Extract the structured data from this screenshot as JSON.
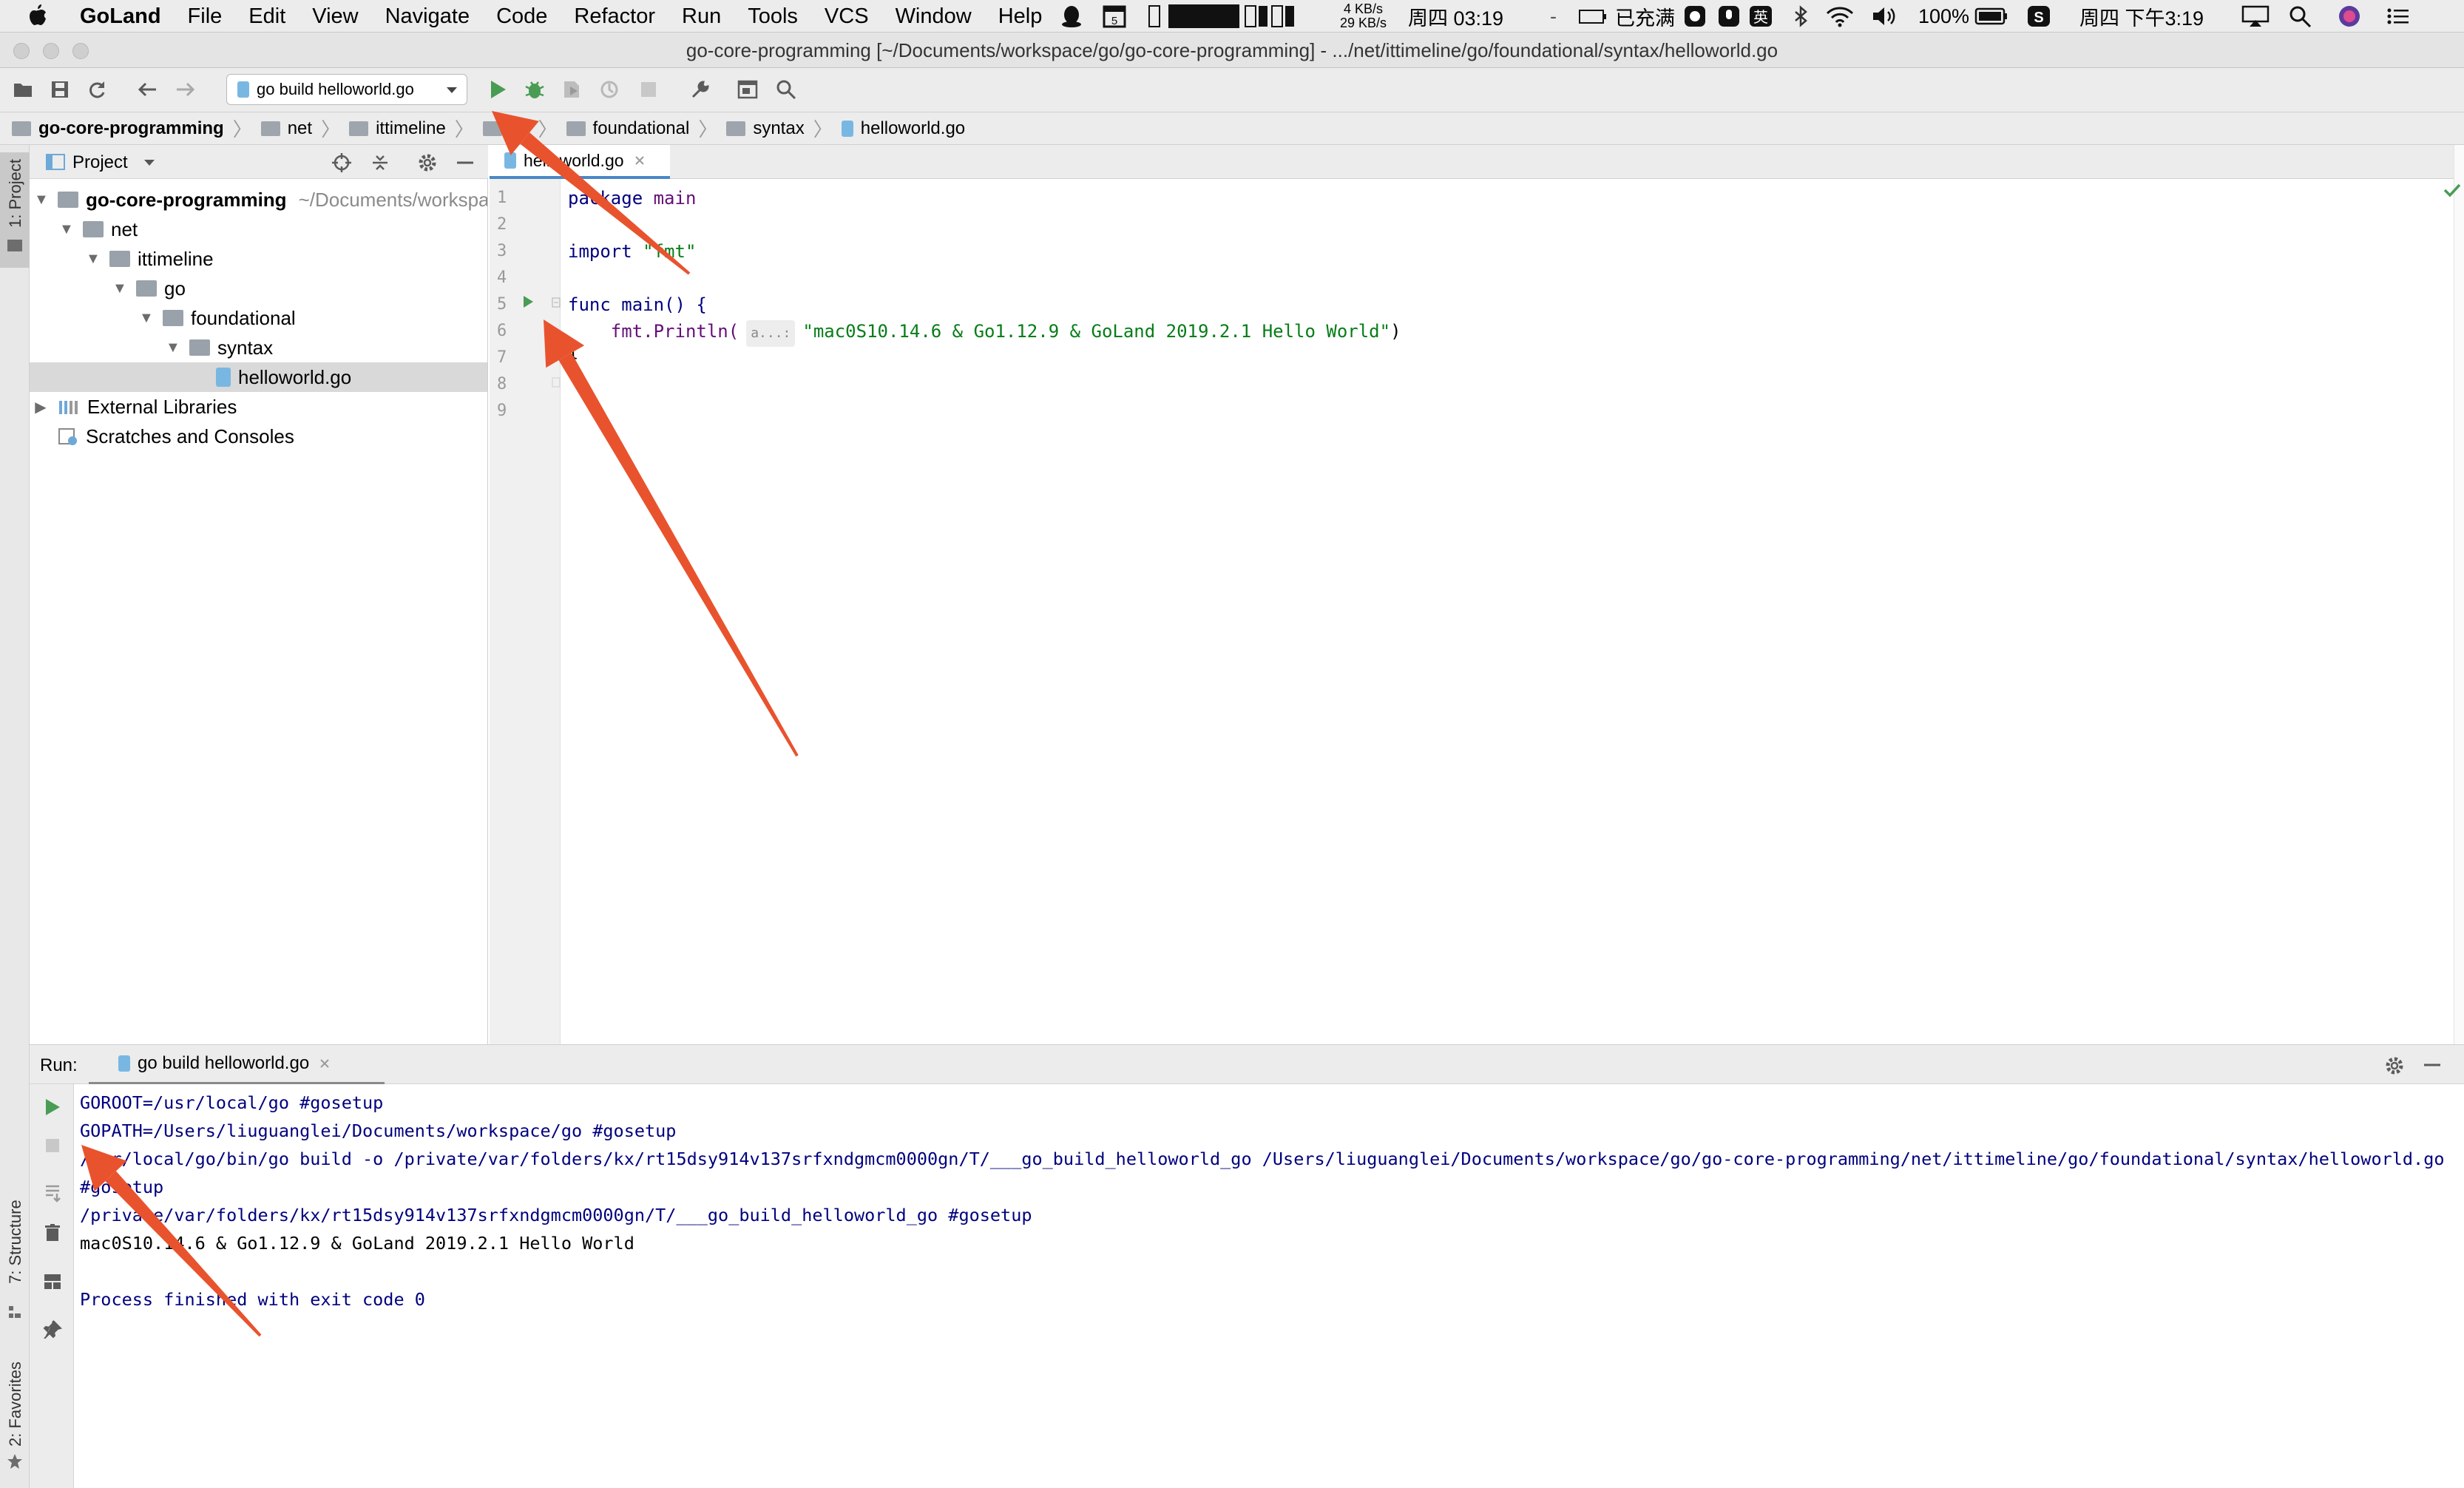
{
  "menubar": {
    "app": "GoLand",
    "menus": [
      "File",
      "Edit",
      "View",
      "Navigate",
      "Code",
      "Refactor",
      "Run",
      "Tools",
      "VCS",
      "Window",
      "Help"
    ],
    "status": {
      "net_up": "4 KB/s",
      "net_down": "29 KB/s",
      "clock_small": "周四 03:19",
      "battery_status": "已充满",
      "input_method": "英",
      "battery": "100%",
      "clock": "周四 下午3:19"
    }
  },
  "window": {
    "title": "go-core-programming [~/Documents/workspace/go/go-core-programming] - .../net/ittimeline/go/foundational/syntax/helloworld.go"
  },
  "toolbar": {
    "run_config": "go build helloworld.go"
  },
  "navbar": {
    "crumbs": [
      "go-core-programming",
      "net",
      "ittimeline",
      "go",
      "foundational",
      "syntax",
      "helloworld.go"
    ]
  },
  "side_tabs": {
    "project": "1: Project",
    "structure": "7: Structure",
    "favorites": "2: Favorites"
  },
  "project_panel": {
    "title": "Project",
    "tree": [
      {
        "label": "go-core-programming",
        "path": "~/Documents/workspace/go/go-core-programming"
      },
      {
        "label": "net"
      },
      {
        "label": "ittimeline"
      },
      {
        "label": "go"
      },
      {
        "label": "foundational"
      },
      {
        "label": "syntax"
      },
      {
        "label": "helloworld.go"
      },
      {
        "label": "External Libraries"
      },
      {
        "label": "Scratches and Consoles"
      }
    ]
  },
  "editor": {
    "tab": "helloworld.go",
    "line_numbers": [
      "1",
      "2",
      "3",
      "4",
      "5",
      "6",
      "7",
      "8",
      "9"
    ],
    "code": {
      "l1_kw": "package",
      "l1_name": " main",
      "l3_kw": "import",
      "l3_str": " \"fmt\"",
      "l5": "func main() {",
      "l6_call": "    fmt.Println(",
      "l6_hint": "a...:",
      "l6_str": "\"mac0S10.14.6 & Go1.12.9 & GoLand 2019.2.1 Hello World\"",
      "l6_close": ")",
      "l7": "}"
    }
  },
  "run_panel": {
    "label": "Run:",
    "tab": "go build helloworld.go",
    "output": [
      "GOROOT=/usr/local/go #gosetup",
      "GOPATH=/Users/liuguanglei/Documents/workspace/go #gosetup",
      "/usr/local/go/bin/go build -o /private/var/folders/kx/rt15dsy914v137srfxndgmcm0000gn/T/___go_build_helloworld_go /Users/liuguanglei/Documents/workspace/go/go-core-programming/net/ittimeline/go/foundational/syntax/helloworld.go",
      "#gosetup",
      "/private/var/folders/kx/rt15dsy914v137srfxndgmcm0000gn/T/___go_build_helloworld_go #gosetup",
      "mac0S10.14.6 & Go1.12.9 & GoLand 2019.2.1 Hello World",
      "",
      "Process finished with exit code 0"
    ]
  },
  "colors": {
    "annotation_arrow": "#e8532e",
    "run_green": "#499c54",
    "keyword_navy": "#000080",
    "string_green": "#067d17"
  }
}
